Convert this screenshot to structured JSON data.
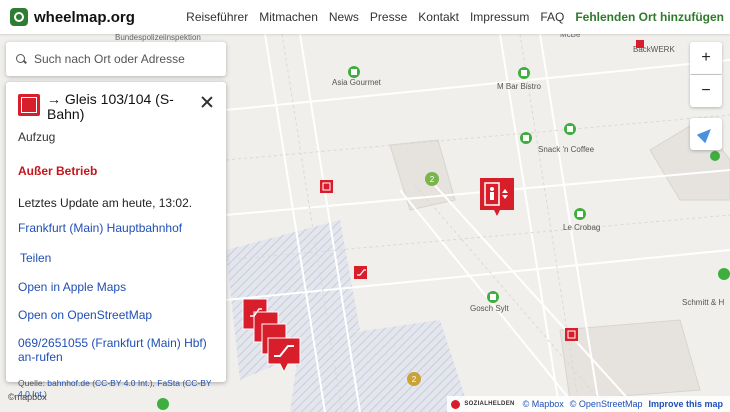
{
  "brand": {
    "name": "wheelmap.org"
  },
  "nav": [
    "Reiseführer",
    "Mitmachen",
    "News",
    "Presse",
    "Kontakt",
    "Impressum",
    "FAQ",
    "Fehlenden Ort hinzufügen"
  ],
  "search": {
    "placeholder": "Such nach Ort oder Adresse"
  },
  "panel": {
    "title": "→ Gleis 103/104 (S-Bahn)",
    "category": "Aufzug",
    "status": "Außer Betrieb",
    "update": "Letztes Update am heute, 13:02.",
    "station_link": "Frankfurt (Main) Hauptbahnhof",
    "share": "Teilen",
    "apple_maps": "Open in Apple Maps",
    "osm": "Open on OpenStreetMap",
    "phone": "069/2651055 (Frankfurt (Main) Hbf) an-rufen",
    "source_prefix": "Quelle: ",
    "source_1": "bahnhof.de",
    "source_1_lic": "CC-BY 4.0 Int.",
    "source_2": "FaSta",
    "source_2_lic": "CC-BY 4.0 Int."
  },
  "controls": {
    "zoom_in": "+",
    "zoom_out": "−"
  },
  "map_labels": {
    "bundespolizei": "Bundespolizeiinspektion",
    "mcbe": "McBe",
    "backwerk": "BackWERK",
    "asia_gourmet": "Asia Gourmet",
    "mbar": "M Bar Bistro",
    "snack": "Snack 'n Coffee",
    "crobag": "Le Crobag",
    "schmitt": "Schmitt & H",
    "gosch": "Gosch Sylt",
    "cluster_2a": "2",
    "cluster_2b": "2"
  },
  "footer": {
    "mapbox": "©mapbox",
    "sozialhelden": "SOZIALHELDEN",
    "mapbox_attr": "© Mapbox",
    "osm_attr": "© OpenStreetMap",
    "improve": "Improve this map"
  },
  "colors": {
    "marker_red": "#d91e2b",
    "poi_green": "#3fae3f",
    "link": "#1f4fb5",
    "status_red": "#c4161c"
  }
}
